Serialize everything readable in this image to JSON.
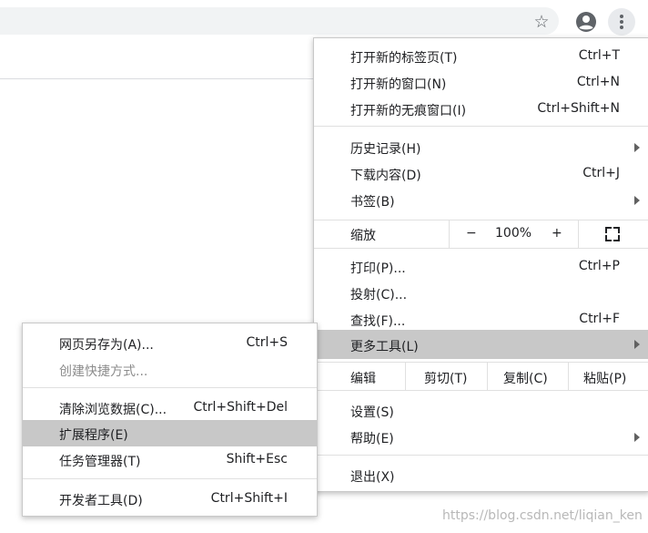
{
  "browser": {
    "star_icon": "star-outline-icon",
    "profile_icon": "account-circle-icon",
    "menu_icon": "three-dots-vertical-icon"
  },
  "main_menu": {
    "new_tab": {
      "label": "打开新的标签页(T)",
      "shortcut": "Ctrl+T"
    },
    "new_window": {
      "label": "打开新的窗口(N)",
      "shortcut": "Ctrl+N"
    },
    "new_incognito": {
      "label": "打开新的无痕窗口(I)",
      "shortcut": "Ctrl+Shift+N"
    },
    "history": {
      "label": "历史记录(H)"
    },
    "downloads": {
      "label": "下载内容(D)",
      "shortcut": "Ctrl+J"
    },
    "bookmarks": {
      "label": "书签(B)"
    },
    "zoom": {
      "label": "缩放",
      "minus": "−",
      "value": "100%",
      "plus": "+"
    },
    "print": {
      "label": "打印(P)...",
      "shortcut": "Ctrl+P"
    },
    "cast": {
      "label": "投射(C)..."
    },
    "find": {
      "label": "查找(F)...",
      "shortcut": "Ctrl+F"
    },
    "more_tools": {
      "label": "更多工具(L)"
    },
    "edit": {
      "label": "编辑",
      "cut": "剪切(T)",
      "copy": "复制(C)",
      "paste": "粘贴(P)"
    },
    "settings": {
      "label": "设置(S)"
    },
    "help": {
      "label": "帮助(E)"
    },
    "exit": {
      "label": "退出(X)"
    }
  },
  "more_tools_submenu": {
    "save_page": {
      "label": "网页另存为(A)...",
      "shortcut": "Ctrl+S"
    },
    "create_shortcut": {
      "label": "创建快捷方式..."
    },
    "clear_data": {
      "label": "清除浏览数据(C)...",
      "shortcut": "Ctrl+Shift+Del"
    },
    "extensions": {
      "label": "扩展程序(E)"
    },
    "task_manager": {
      "label": "任务管理器(T)",
      "shortcut": "Shift+Esc"
    },
    "dev_tools": {
      "label": "开发者工具(D)",
      "shortcut": "Ctrl+Shift+I"
    }
  },
  "watermark": "https://blog.csdn.net/liqian_ken",
  "colors": {
    "highlight": "#c8c8c8",
    "menu_bg": "#ffffff",
    "omnibox": "#f1f3f4"
  }
}
